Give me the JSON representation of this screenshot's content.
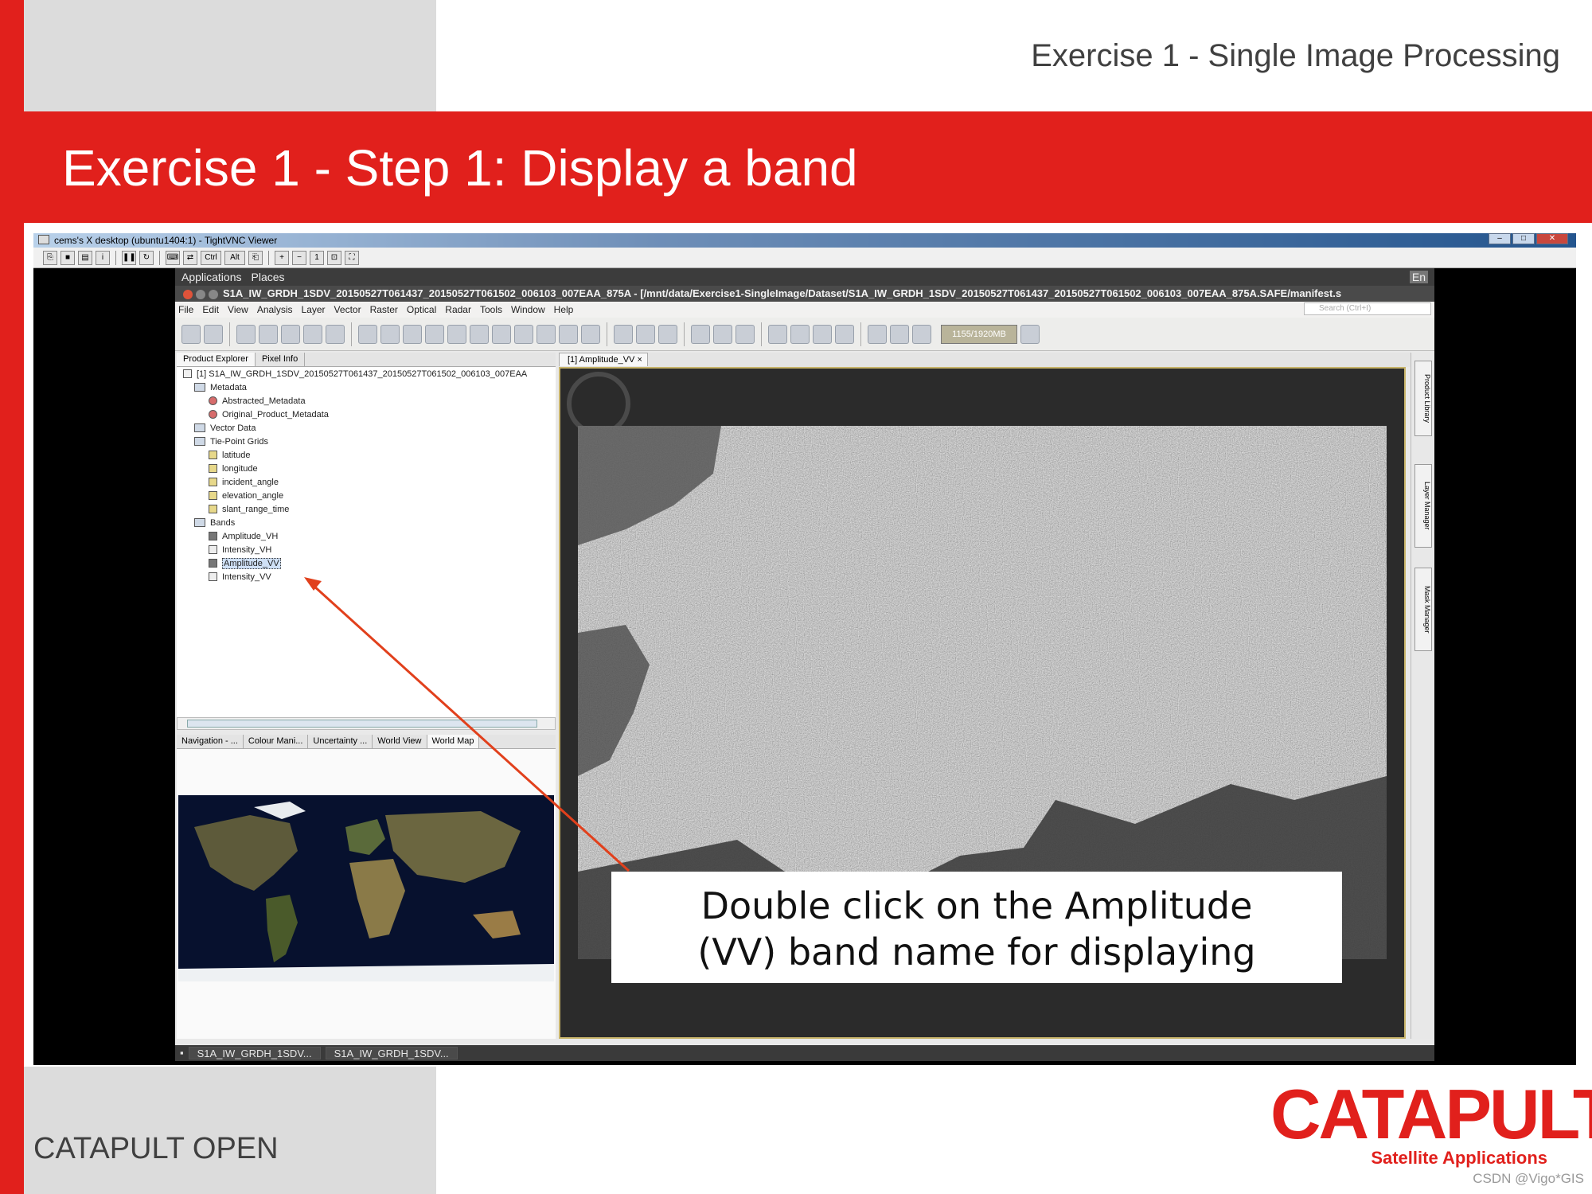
{
  "slide": {
    "header": "Exercise 1 - Single Image Processing",
    "title": "Exercise 1 - Step 1: Display a band",
    "footer": "CATAPULT OPEN",
    "logo_word": "CATAPULT",
    "logo_sub": "Satellite Applications",
    "watermark": "CSDN @Vigo*GIS",
    "callout_line1": "Double click on the Amplitude",
    "callout_line2": "(VV) band name for displaying",
    "accent_color": "#e1201c"
  },
  "vnc": {
    "title": "cems's X desktop (ubuntu1404:1) - TightVNC Viewer",
    "toolbar_icons": [
      "new-connection-icon",
      "save-icon",
      "options-icon",
      "info-icon",
      "pause-icon",
      "refresh-icon",
      "send-keys-icon",
      "file-transfer-icon",
      "ctrl-key-icon",
      "alt-key-icon",
      "clipboard-icon",
      "zoom-in-icon",
      "zoom-out-icon",
      "zoom-100-icon",
      "zoom-fit-icon",
      "fullscreen-icon"
    ],
    "ctrl_label": "Ctrl",
    "alt_label": "Alt"
  },
  "gnome": {
    "applications": "Applications",
    "places": "Places",
    "lang": "En"
  },
  "snap": {
    "window_title": "S1A_IW_GRDH_1SDV_20150527T061437_20150527T061502_006103_007EAA_875A - [/mnt/data/Exercise1-SingleImage/Dataset/S1A_IW_GRDH_1SDV_20150527T061437_20150527T061502_006103_007EAA_875A.SAFE/manifest.s",
    "menu": [
      "File",
      "Edit",
      "View",
      "Analysis",
      "Layer",
      "Vector",
      "Raster",
      "Optical",
      "Radar",
      "Tools",
      "Window",
      "Help"
    ],
    "search_placeholder": "Search (Ctrl+I)",
    "memory": "1155/1920MB",
    "product_tabs": [
      "Product Explorer",
      "Pixel Info"
    ],
    "tree": {
      "product": "[1] S1A_IW_GRDH_1SDV_20150527T061437_20150527T061502_006103_007EAA",
      "metadata": "Metadata",
      "abstracted": "Abstracted_Metadata",
      "original": "Original_Product_Metadata",
      "vector": "Vector Data",
      "tiepoint": "Tie-Point Grids",
      "tpg": [
        "latitude",
        "longitude",
        "incident_angle",
        "elevation_angle",
        "slant_range_time"
      ],
      "bands_label": "Bands",
      "bands": [
        "Amplitude_VH",
        "Intensity_VH",
        "Amplitude_VV",
        "Intensity_VV"
      ],
      "selected": "Amplitude_VV"
    },
    "nav_tabs": [
      "Navigation - ...",
      "Colour Mani...",
      "Uncertainty ...",
      "World View",
      "World Map"
    ],
    "image_tab": "[1] Amplitude_VV",
    "side_tabs": [
      "Product Library",
      "Layer Manager",
      "Mask Manager"
    ],
    "taskbar": [
      "S1A_IW_GRDH_1SDV...",
      "S1A_IW_GRDH_1SDV..."
    ]
  }
}
